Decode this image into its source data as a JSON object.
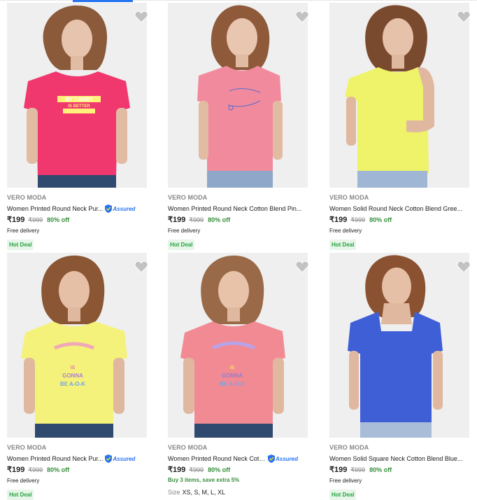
{
  "colors": {
    "accent": "#2874f0",
    "discount": "#388e3c",
    "hot_deal_bg": "#e8f5e9",
    "muted": "#878787"
  },
  "icons": {
    "wishlist": "heart-icon",
    "assured": "shield-check-icon"
  },
  "products": [
    {
      "brand": "VERO MODA",
      "title": "Women Printed Round Neck Pur...",
      "assured": true,
      "assured_label": "Assured",
      "price": "₹199",
      "mrp": "₹999",
      "discount": "80% off",
      "delivery": "Free delivery",
      "badge": "Hot Deal",
      "shirt_color": "#f0376e",
      "print_text_1": "MY T-SHIRT",
      "print_text_2": "IS BETTER"
    },
    {
      "brand": "VERO MODA",
      "title": "Women Printed Round Neck Cotton Blend Pin...",
      "assured": false,
      "price": "₹199",
      "mrp": "₹999",
      "discount": "80% off",
      "delivery": "Free delivery",
      "badge": "Hot Deal",
      "shirt_color": "#f28a9e"
    },
    {
      "brand": "VERO MODA",
      "title": "Women Solid Round Neck Cotton Blend Gree...",
      "assured": false,
      "price": "₹199",
      "mrp": "₹999",
      "discount": "80% off",
      "delivery": "Free delivery",
      "badge": "Hot Deal",
      "shirt_color": "#eff36a"
    },
    {
      "brand": "VERO MODA",
      "title": "Women Printed Round Neck Pur...",
      "assured": true,
      "assured_label": "Assured",
      "price": "₹199",
      "mrp": "₹999",
      "discount": "80% off",
      "delivery": "Free delivery",
      "badge": "Hot Deal",
      "shirt_color": "#f4f27a",
      "print_text_1": "IS",
      "print_text_2": "GONNA",
      "print_text_3": "BE A-O-K"
    },
    {
      "brand": "VERO MODA",
      "title": "Women Printed Round Neck Cott...",
      "assured": true,
      "assured_label": "Assured",
      "price": "₹199",
      "mrp": "₹999",
      "discount": "80% off",
      "offer": "Buy 3 items, save extra 5%",
      "size_label": "Size",
      "sizes": "XS, S, M, L, XL",
      "shirt_color": "#f28a94",
      "print_text_1": "IS",
      "print_text_2": "GONNA",
      "print_text_3": "BE A-O-K"
    },
    {
      "brand": "VERO MODA",
      "title": "Women Solid Square Neck Cotton Blend Blue...",
      "assured": false,
      "price": "₹199",
      "mrp": "₹999",
      "discount": "80% off",
      "delivery": "Free delivery",
      "badge": "Hot Deal",
      "shirt_color": "#3f5fd6"
    }
  ]
}
